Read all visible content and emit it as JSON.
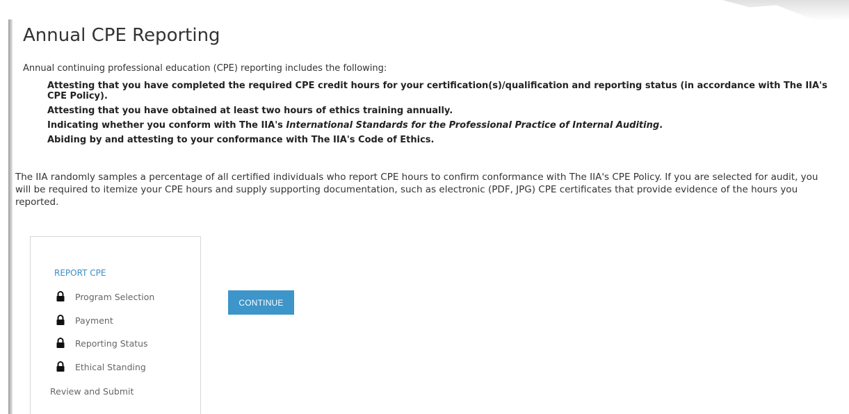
{
  "page": {
    "title": "Annual CPE Reporting",
    "intro": "Annual continuing professional education (CPE) reporting includes the following:",
    "requirements": [
      {
        "pre": "Attesting that you have completed the required CPE credit hours for your certification(s)/qualification and reporting status (in accordance with The IIA's CPE Policy).",
        "em": "",
        "post": ""
      },
      {
        "pre": "Attesting that you have obtained at least two hours of ethics training annually.",
        "em": "",
        "post": ""
      },
      {
        "pre": "Indicating whether you conform with The IIA's ",
        "em": "International Standards for the Professional Practice of Internal Auditing",
        "post": "."
      },
      {
        "pre": "Abiding by and attesting to your conformance with The IIA's Code of Ethics.",
        "em": "",
        "post": ""
      }
    ],
    "audit_text": "The IIA randomly samples a percentage of all certified individuals who report CPE hours to confirm conformance with The IIA's CPE Policy. If you are selected for audit, you will be required to itemize your CPE hours and supply supporting documentation, such as electronic (PDF, JPG) CPE certificates that provide evidence of the hours you reported."
  },
  "steps": {
    "title": "REPORT CPE",
    "items": [
      {
        "label": "Program Selection",
        "icon": "lock-icon"
      },
      {
        "label": "Payment",
        "icon": "lock-icon"
      },
      {
        "label": "Reporting Status",
        "icon": "lock-icon"
      },
      {
        "label": "Ethical Standing",
        "icon": "lock-icon"
      }
    ],
    "final": "Review and Submit"
  },
  "actions": {
    "continue_label": "CONTINUE"
  },
  "colors": {
    "accent": "#3d95c9",
    "steps_title": "#3b8cc4",
    "text": "#333333"
  }
}
